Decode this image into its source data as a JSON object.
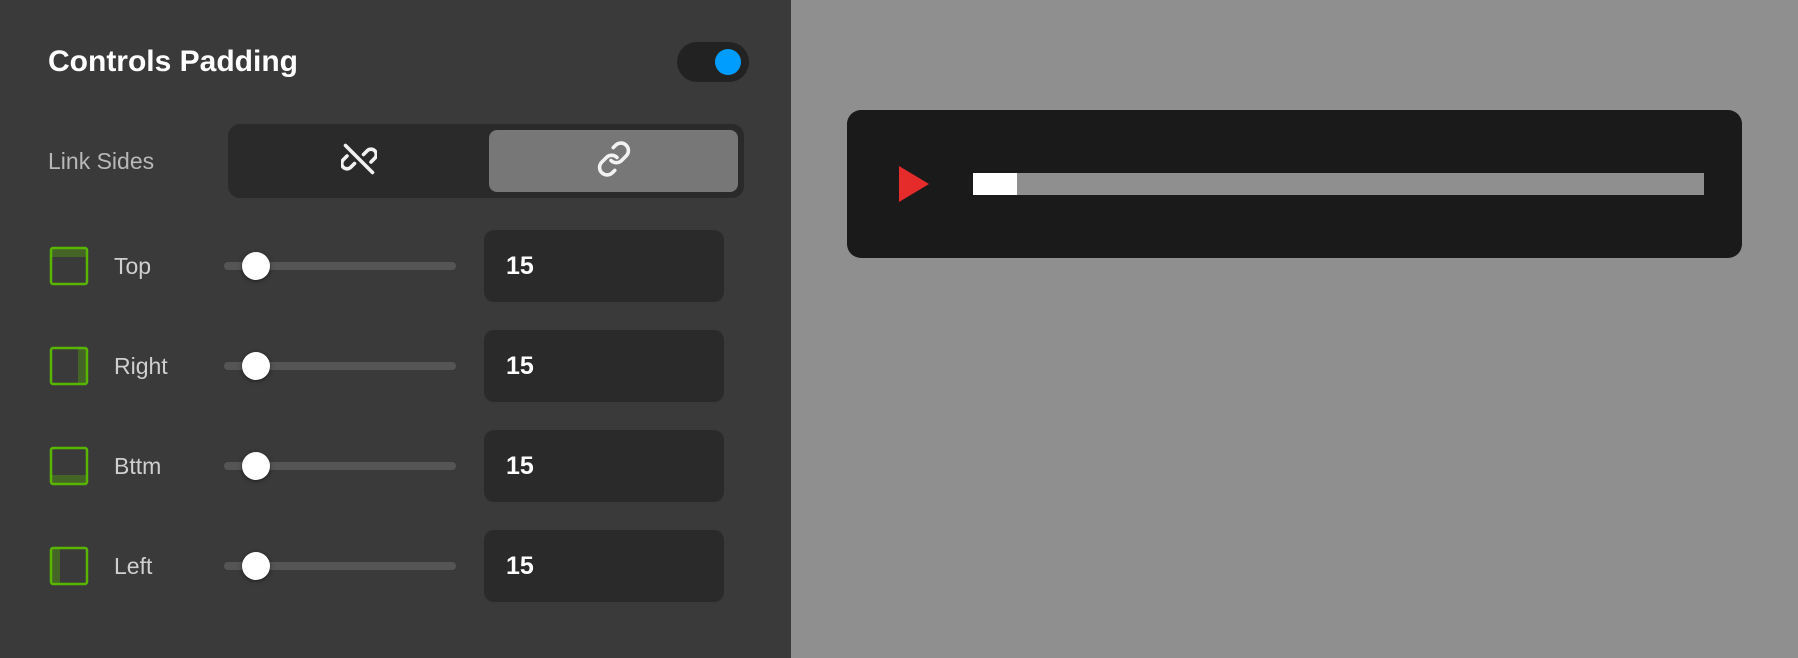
{
  "panel": {
    "title": "Controls Padding",
    "toggle_on": true,
    "link_sides": {
      "label": "Link Sides",
      "linked": true
    },
    "sides": [
      {
        "key": "top",
        "label": "Top",
        "value": "15",
        "unit": "px",
        "slider_percent": 14
      },
      {
        "key": "right",
        "label": "Right",
        "value": "15",
        "unit": "px",
        "slider_percent": 14
      },
      {
        "key": "bottom",
        "label": "Bttm",
        "value": "15",
        "unit": "px",
        "slider_percent": 14
      },
      {
        "key": "left",
        "label": "Left",
        "value": "15",
        "unit": "px",
        "slider_percent": 14
      }
    ]
  },
  "preview": {
    "player": {
      "progress_percent": 6
    }
  },
  "colors": {
    "accent_blue": "#009dff",
    "accent_green": "#59b600",
    "play_red": "#e62b2b"
  }
}
